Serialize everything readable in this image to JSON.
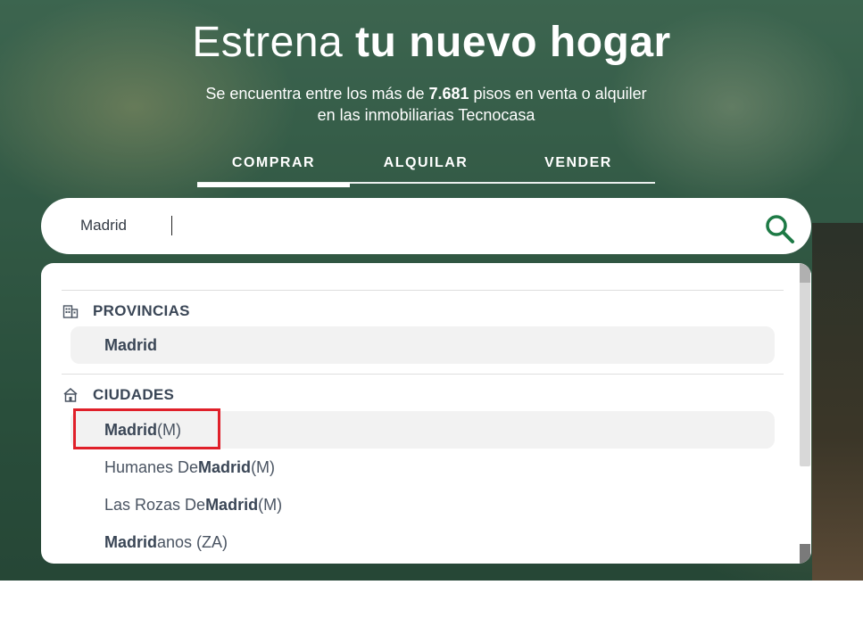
{
  "hero": {
    "title_light": "Estrena ",
    "title_bold": "tu nuevo hogar",
    "subtitle_pre": "Se encuentra entre los más de ",
    "subtitle_count": "7.681",
    "subtitle_post": " pisos en venta o alquiler",
    "subtitle_line2": "en las inmobiliarias Tecnocasa"
  },
  "tabs": [
    {
      "label": "COMPRAR",
      "active": true
    },
    {
      "label": "ALQUILAR",
      "active": false
    },
    {
      "label": "VENDER",
      "active": false
    }
  ],
  "search": {
    "value": "Madrid",
    "icon": "search-icon",
    "accent_color": "#1d7a45"
  },
  "dropdown": {
    "groups": [
      {
        "header": "PROVINCIAS",
        "icon": "building-icon",
        "items": [
          {
            "pre": "",
            "bold": "Madrid",
            "post": ""
          }
        ]
      },
      {
        "header": "CIUDADES",
        "icon": "house-icon",
        "items": [
          {
            "pre": "",
            "bold": "Madrid",
            "post": " (M)"
          },
          {
            "pre": "Humanes De ",
            "bold": "Madrid",
            "post": " (M)"
          },
          {
            "pre": "Las Rozas De ",
            "bold": "Madrid",
            "post": " (M)"
          },
          {
            "pre": "",
            "bold": "Madrid",
            "post": "anos (ZA)"
          }
        ]
      }
    ]
  },
  "annotation": {
    "color": "#e0202a"
  }
}
